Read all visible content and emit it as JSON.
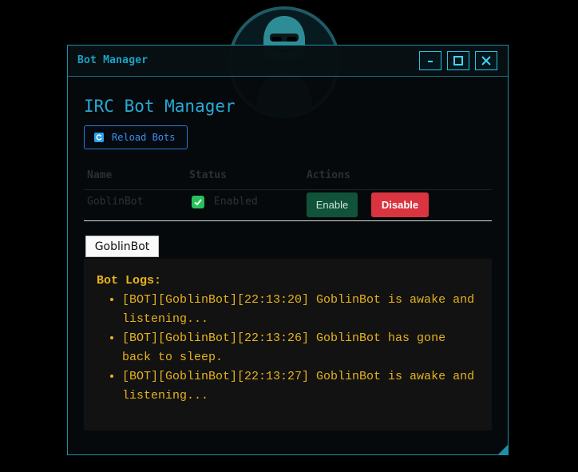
{
  "window": {
    "title": "Bot Manager",
    "controls": {
      "minimize_icon": "minimize-icon",
      "maximize_icon": "maximize-icon",
      "close_icon": "close-icon"
    }
  },
  "main": {
    "heading": "IRC Bot Manager",
    "reload_label": "Reload Bots",
    "table": {
      "headers": [
        "Name",
        "Status",
        "Actions"
      ],
      "rows": [
        {
          "name": "GoblinBot",
          "status": "Enabled",
          "enabled": true,
          "enable_label": "Enable",
          "disable_label": "Disable"
        }
      ]
    },
    "active_tab": "GoblinBot",
    "logs": {
      "title": "Bot Logs:",
      "entries": [
        "[BOT][GoblinBot][22:13:20] GoblinBot is awake and listening...",
        "[BOT][GoblinBot][22:13:26] GoblinBot has gone back to sleep.",
        "[BOT][GoblinBot][22:13:27] GoblinBot is awake and listening..."
      ]
    }
  },
  "colors": {
    "accent": "#1aa3c7",
    "enable": "#10523a",
    "disable": "#d9343f",
    "log_text": "#e6b21c"
  }
}
